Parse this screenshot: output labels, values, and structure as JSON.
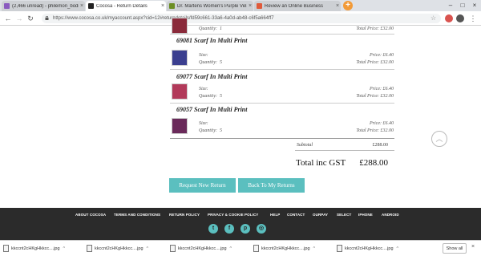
{
  "browser": {
    "tabs": [
      {
        "label": "(2,466 unread) - philemon_bodi@...",
        "active": false,
        "color": "#8a5bbf"
      },
      {
        "label": "Cocosa - Return Details",
        "active": true,
        "color": "#222222"
      },
      {
        "label": "Dr. Martens Women's Purple Vel...",
        "active": false,
        "color": "#6b8e23"
      },
      {
        "label": "Review an Online Business",
        "active": false,
        "color": "#e05a3a"
      }
    ],
    "new_tab": "+",
    "url": "https://www.cocosa.co.uk/myaccount.aspx?cid=12#returndetails/fd59c661-33a6-4a0d-ab48-c6f5a664ff7"
  },
  "items_top": {
    "quantity_label": "Quantity:",
    "quantity_value": "1",
    "total_price": "Total Price: £32.00"
  },
  "items": [
    {
      "title": "69081 Scarf In Multi Print",
      "size_label": "Size:",
      "quantity_label": "Quantity:",
      "quantity_value": "5",
      "price": "Price: £6.40",
      "total_price": "Total Price: £32.00",
      "thumb_color": "#3b3f8f"
    },
    {
      "title": "69077 Scarf In Multi Print",
      "size_label": "Size:",
      "quantity_label": "Quantity:",
      "quantity_value": "5",
      "price": "Price: £6.40",
      "total_price": "Total Price: £32.00",
      "thumb_color": "#b23a5a"
    },
    {
      "title": "69057 Scarf In Multi Print",
      "size_label": "Size:",
      "quantity_label": "Quantity:",
      "quantity_value": "5",
      "price": "Price: £6.40",
      "total_price": "Total Price: £32.00",
      "thumb_color": "#6a2a5a"
    }
  ],
  "summary": {
    "subtotal_label": "Subtotal",
    "subtotal_value": "£288.00",
    "total_label": "Total inc GST",
    "total_value": "£288.00"
  },
  "buttons": {
    "request_return": "Request New Return",
    "back_to_returns": "Back To My Returns"
  },
  "footer": {
    "links": [
      "ABOUT COCOSA",
      "TERMS AND CONDITIONS",
      "RETURN POLICY",
      "PRIVACY & COOKIE POLICY",
      "HELP",
      "CONTACT",
      "OURPAY",
      "SELECT",
      "IPHONE",
      "ANDROID"
    ],
    "social": [
      "twitter-icon",
      "facebook-icon",
      "pinterest-icon",
      "instagram-icon"
    ]
  },
  "downloads": {
    "files": [
      "kkccnt2cHKgHkkcc....jpg",
      "kkccnt2cHKgHkkcc....jpg",
      "kkccnt2cHKgHkkcc....jpg",
      "kkccnt2cHKgHkkcc....jpg",
      "kkccnt2cHKgHkkcc....jpg"
    ],
    "show_all": "Show all"
  },
  "colors": {
    "accent": "#5bbfbf",
    "footer_bg": "#2b2b2b"
  }
}
